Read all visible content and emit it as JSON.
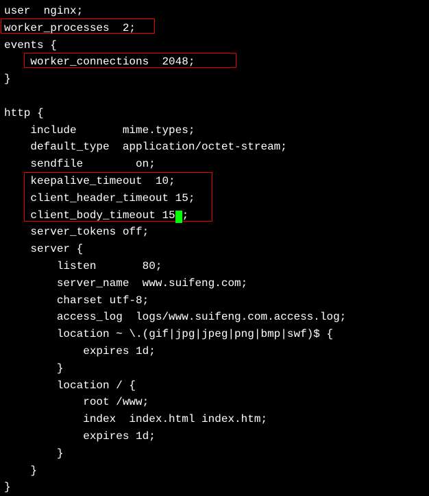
{
  "config": {
    "l1": "user  nginx;",
    "l2": "worker_processes  2;",
    "l3": "events {",
    "l4": "    worker_connections  2048;",
    "l5": "}",
    "l6": "",
    "l7": "http {",
    "l8": "    include       mime.types;",
    "l9": "    default_type  application/octet-stream;",
    "l10": "    sendfile        on;",
    "l11": "    keepalive_timeout  10;",
    "l12": "    client_header_timeout 15;",
    "l13a": "    client_body_timeout 15",
    "l13b": ";",
    "l14": "    server_tokens off;",
    "l15": "    server {",
    "l16": "        listen       80;",
    "l17": "        server_name  www.suifeng.com;",
    "l18": "        charset utf-8;",
    "l19": "        access_log  logs/www.suifeng.com.access.log;",
    "l20": "        location ~ \\.(gif|jpg|jpeg|png|bmp|swf)$ {",
    "l21": "            expires 1d;",
    "l22": "        }",
    "l23": "        location / {",
    "l24": "            root /www;",
    "l25": "            index  index.html index.htm;",
    "l26": "            expires 1d;",
    "l27": "        }",
    "l28": "    }",
    "l29": "}"
  }
}
